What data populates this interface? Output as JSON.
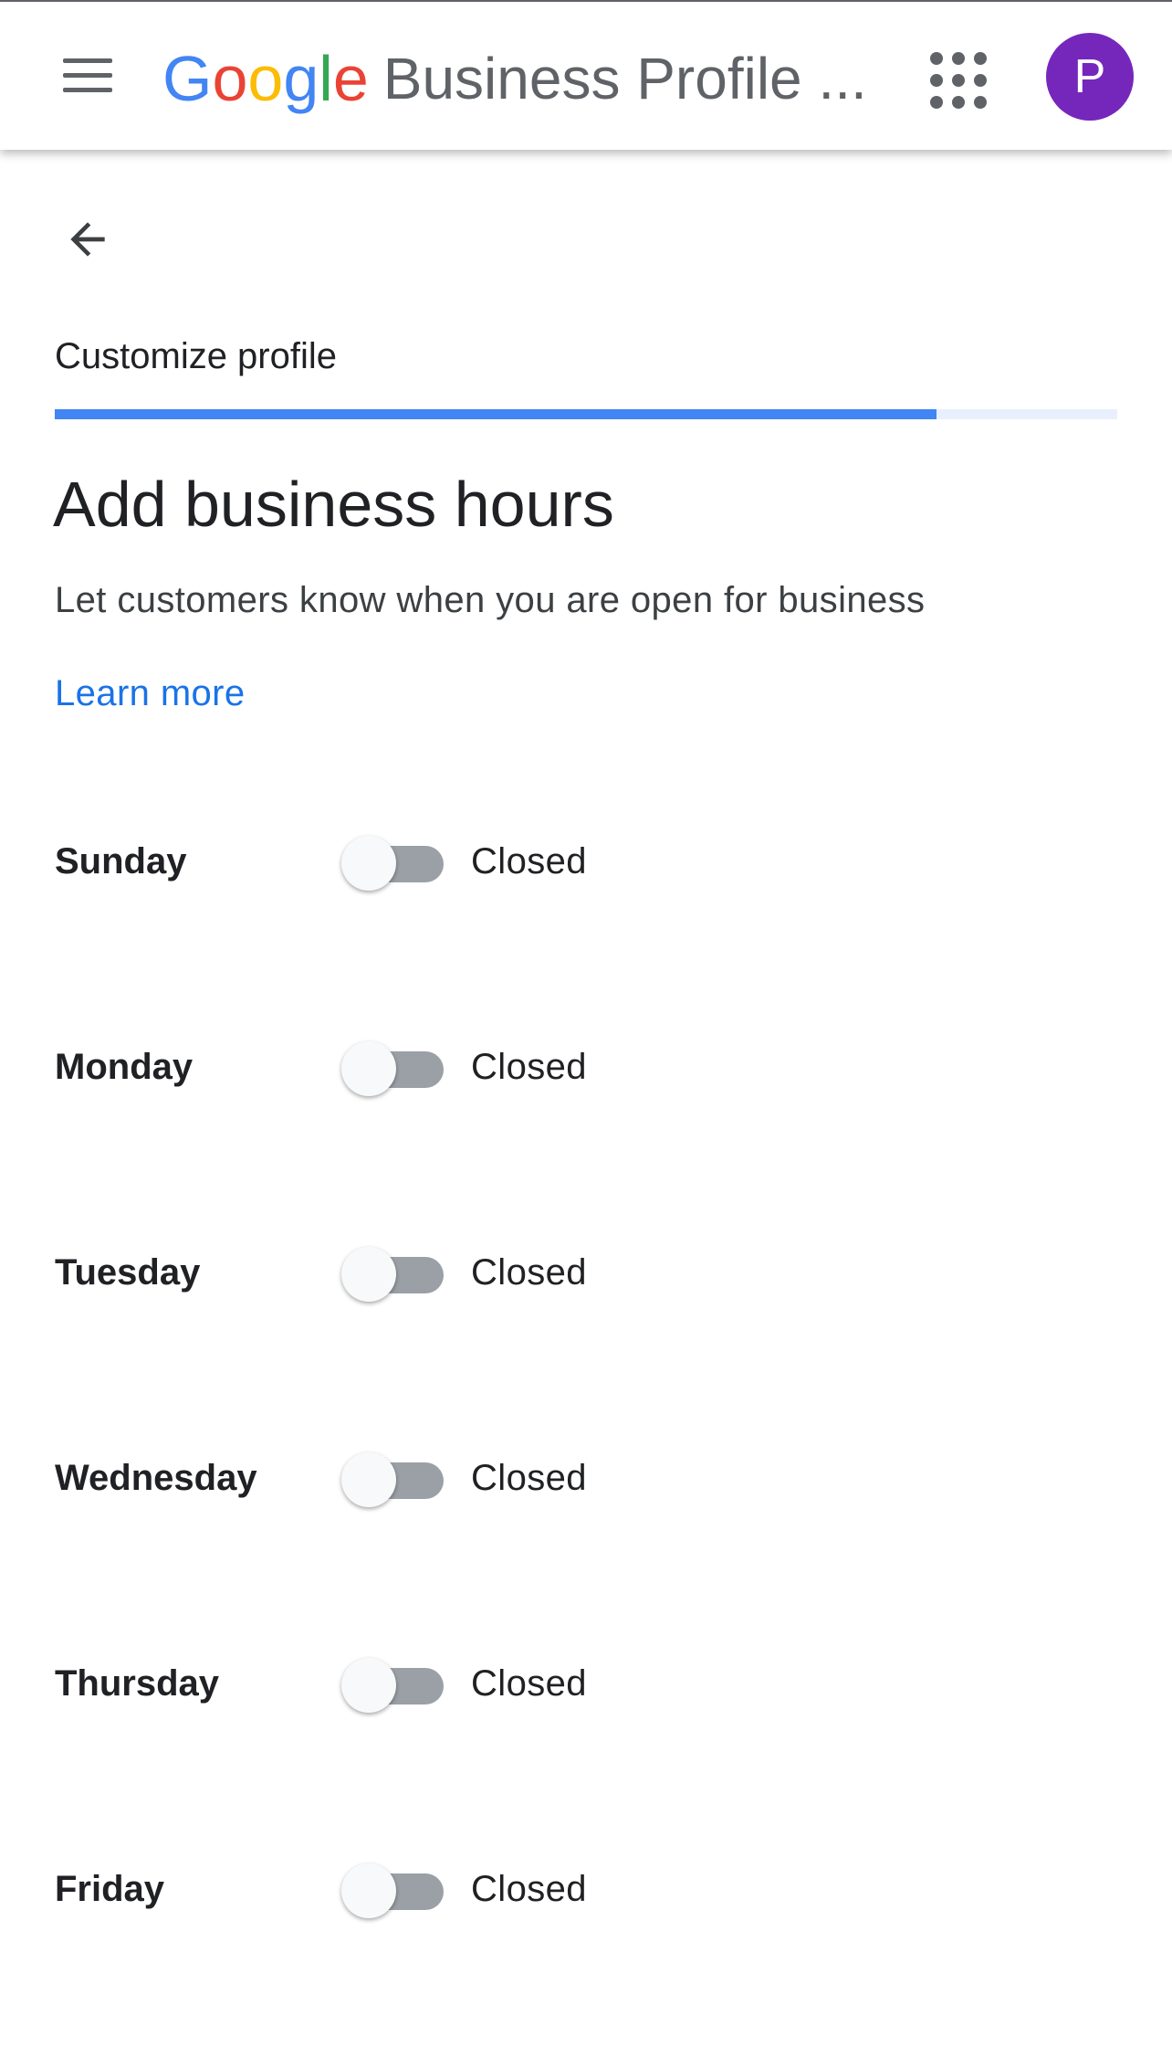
{
  "header": {
    "menu_icon": "hamburger-menu-icon",
    "logo_text": "Google",
    "product_title": "Business Profile ...",
    "apps_icon": "apps-grid-icon",
    "avatar_initial": "P",
    "avatar_color": "#7627bb"
  },
  "nav": {
    "back_icon": "arrow-back-icon"
  },
  "step": {
    "title": "Customize profile",
    "progress_fraction": 0.83,
    "progress_color": "#4285F4"
  },
  "content": {
    "heading": "Add business hours",
    "description": "Let customers know when you are open for business",
    "learn_more": "Learn more"
  },
  "days": [
    {
      "name": "Sunday",
      "open": false,
      "status": "Closed"
    },
    {
      "name": "Monday",
      "open": false,
      "status": "Closed"
    },
    {
      "name": "Tuesday",
      "open": false,
      "status": "Closed"
    },
    {
      "name": "Wednesday",
      "open": false,
      "status": "Closed"
    },
    {
      "name": "Thursday",
      "open": false,
      "status": "Closed"
    },
    {
      "name": "Friday",
      "open": false,
      "status": "Closed"
    }
  ]
}
